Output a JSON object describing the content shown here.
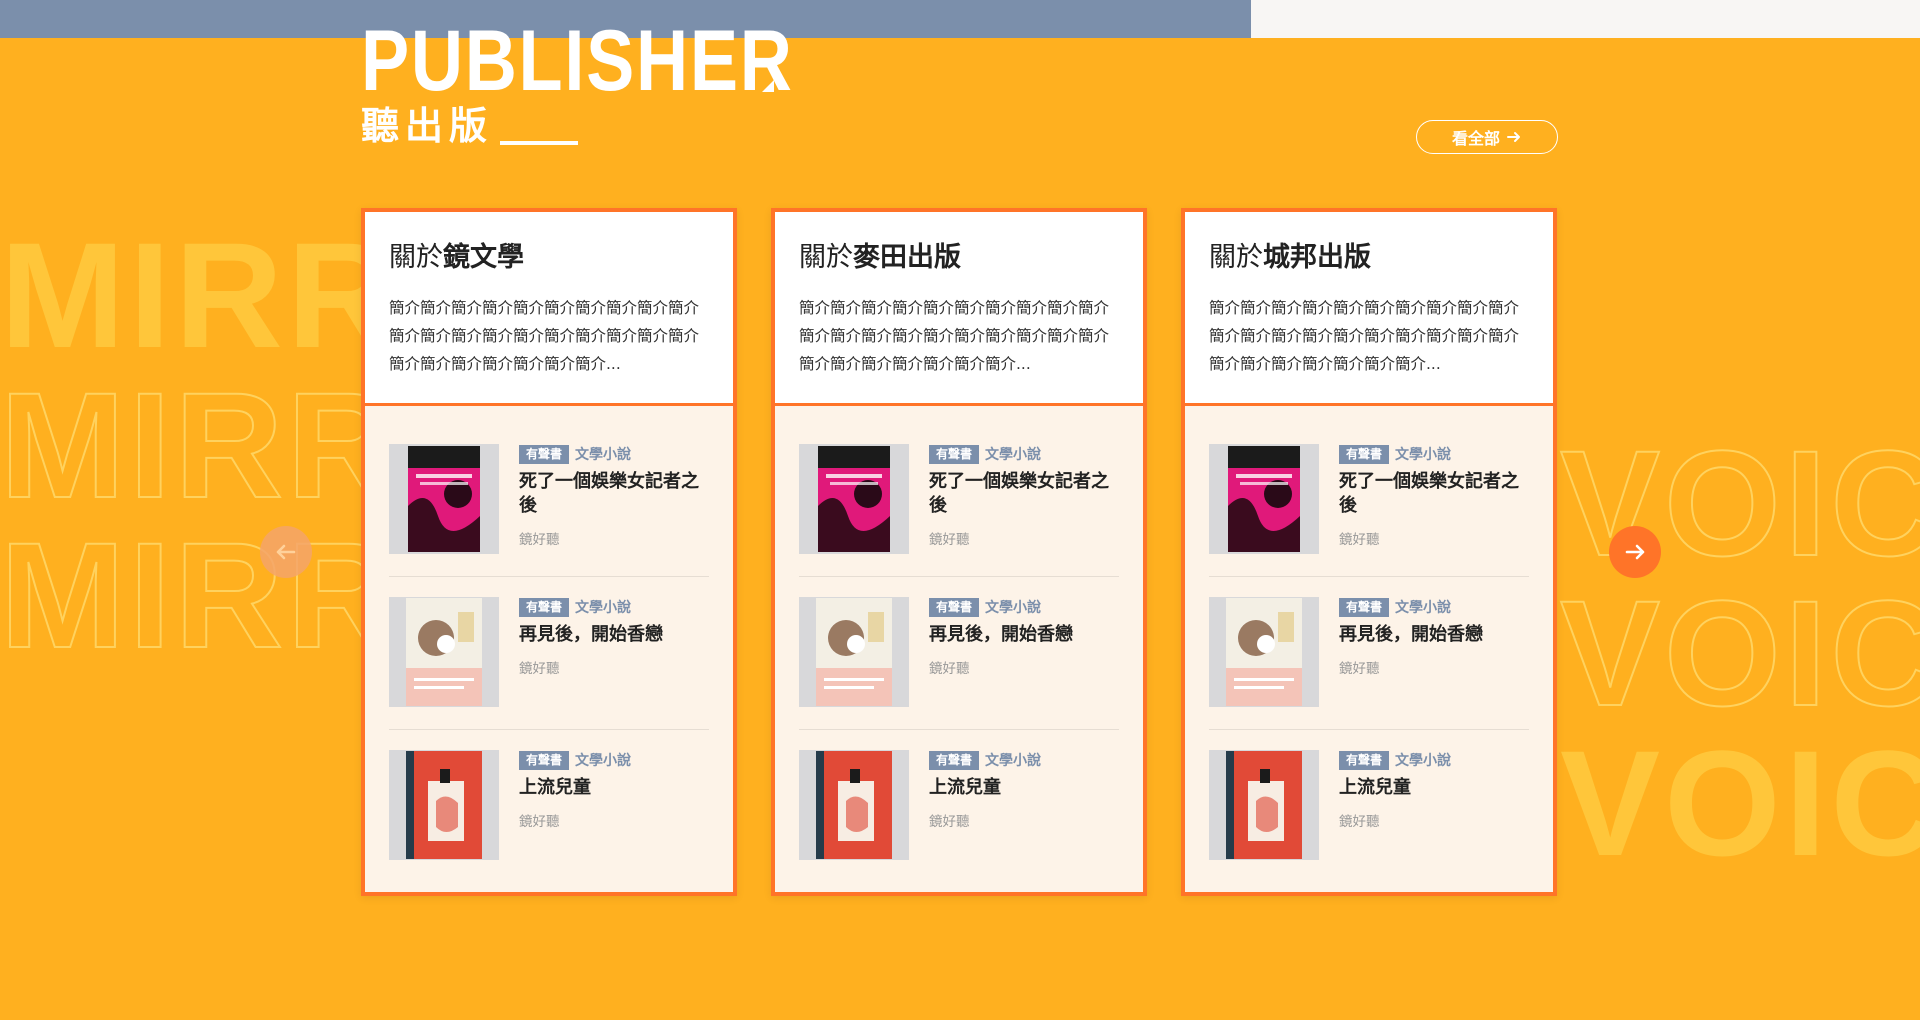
{
  "header": {
    "title_en": "PUBLISHER",
    "title_zh": "聽出版",
    "view_all_label": "看全部"
  },
  "background": {
    "left_word": "MIRROR",
    "right_word": "VOICE"
  },
  "colors": {
    "background": "#FFB01F",
    "accent": "#FF7428",
    "badge": "#7B8FAB",
    "topbar": "#7B8FAB"
  },
  "publishers": [
    {
      "prefix": "關於",
      "name": "鏡文學",
      "desc": "簡介簡介簡介簡介簡介簡介簡介簡介簡介簡介簡介簡介簡介簡介簡介簡介簡介簡介簡介簡介簡介簡介簡介簡介簡介簡介簡介...",
      "books": [
        {
          "badge": "有聲書",
          "genre": "文學小說",
          "title": "死了一個娛樂女記者之後",
          "author": "鏡好聽"
        },
        {
          "badge": "有聲書",
          "genre": "文學小說",
          "title": "再見後，開始香戀",
          "author": "鏡好聽"
        },
        {
          "badge": "有聲書",
          "genre": "文學小說",
          "title": "上流兒童",
          "author": "鏡好聽"
        }
      ]
    },
    {
      "prefix": "關於",
      "name": "麥田出版",
      "desc": "簡介簡介簡介簡介簡介簡介簡介簡介簡介簡介簡介簡介簡介簡介簡介簡介簡介簡介簡介簡介簡介簡介簡介簡介簡介簡介簡介...",
      "books": [
        {
          "badge": "有聲書",
          "genre": "文學小說",
          "title": "死了一個娛樂女記者之後",
          "author": "鏡好聽"
        },
        {
          "badge": "有聲書",
          "genre": "文學小說",
          "title": "再見後，開始香戀",
          "author": "鏡好聽"
        },
        {
          "badge": "有聲書",
          "genre": "文學小說",
          "title": "上流兒童",
          "author": "鏡好聽"
        }
      ]
    },
    {
      "prefix": "關於",
      "name": "城邦出版",
      "desc": "簡介簡介簡介簡介簡介簡介簡介簡介簡介簡介簡介簡介簡介簡介簡介簡介簡介簡介簡介簡介簡介簡介簡介簡介簡介簡介簡介...",
      "books": [
        {
          "badge": "有聲書",
          "genre": "文學小說",
          "title": "死了一個娛樂女記者之後",
          "author": "鏡好聽"
        },
        {
          "badge": "有聲書",
          "genre": "文學小說",
          "title": "再見後，開始香戀",
          "author": "鏡好聽"
        },
        {
          "badge": "有聲書",
          "genre": "文學小說",
          "title": "上流兒童",
          "author": "鏡好聽"
        }
      ]
    }
  ]
}
